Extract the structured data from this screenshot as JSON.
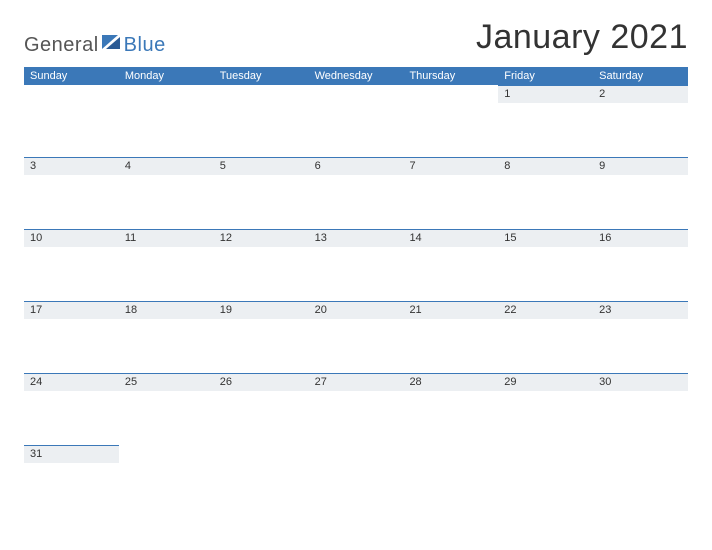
{
  "logo": {
    "part1": "General",
    "part2": "Blue"
  },
  "title": "January 2021",
  "dayHeaders": [
    "Sunday",
    "Monday",
    "Tuesday",
    "Wednesday",
    "Thursday",
    "Friday",
    "Saturday"
  ],
  "weeks": [
    [
      "",
      "",
      "",
      "",
      "",
      "1",
      "2"
    ],
    [
      "3",
      "4",
      "5",
      "6",
      "7",
      "8",
      "9"
    ],
    [
      "10",
      "11",
      "12",
      "13",
      "14",
      "15",
      "16"
    ],
    [
      "17",
      "18",
      "19",
      "20",
      "21",
      "22",
      "23"
    ],
    [
      "24",
      "25",
      "26",
      "27",
      "28",
      "29",
      "30"
    ],
    [
      "31",
      "",
      "",
      "",
      "",
      "",
      ""
    ]
  ]
}
